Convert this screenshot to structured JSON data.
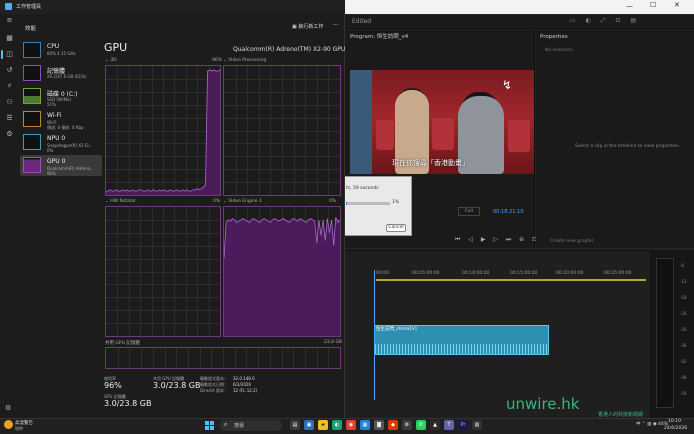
{
  "task_manager": {
    "title": "工作管理員",
    "page_title": "效能",
    "run_new_task": "執行新工作",
    "more": "···",
    "sidebar": [
      {
        "name": "CPU",
        "detail": "60%  4.15 GHz",
        "detail2": ""
      },
      {
        "name": "記憶體",
        "detail": "29.2/47.6 GB (61%)",
        "detail2": ""
      },
      {
        "name": "磁碟 0 (C:)",
        "detail": "SSD (NVMe)",
        "detail2": "51%"
      },
      {
        "name": "Wi-Fi",
        "detail": "Wi-Fi",
        "detail2": "傳送: 0 接收: 0 Kbp"
      },
      {
        "name": "NPU 0",
        "detail": "Snapdragon(R) X2 El...",
        "detail2": "0%"
      },
      {
        "name": "GPU 0",
        "detail": "Qualcomm(R) Adreno...",
        "detail2": "96%"
      }
    ],
    "gpu": {
      "title": "GPU",
      "model": "Qualcomm(R) Adreno(TM) X2-90 GPU",
      "graphs": [
        {
          "label": "3D",
          "pct": "96%"
        },
        {
          "label": "Video Processing",
          "pct": "0%"
        },
        {
          "label": "HW Rotator",
          "pct": "0%"
        },
        {
          "label": "Video Engine 1",
          "pct": "0%"
        }
      ],
      "shared_memory_label": "共用 GPU 記憶體",
      "shared_memory_max": "23.8 GB",
      "stats": {
        "utilization_label": "使用率",
        "utilization_value": "96%",
        "shared_label": "共用 GPU 記憶體",
        "shared_value": "3.0/23.8 GB",
        "gpu_memory_label": "GPU 記憶體",
        "gpu_memory_value": "3.0/23.8 GB",
        "driver_version_label": "驅動程式版本：",
        "driver_version_value": "32.0.148.0",
        "driver_date_label": "驅動程式日期：",
        "driver_date_value": "6/3/2026",
        "directx_label": "DirectX 版本：",
        "directx_value": "12 (FL 12.2)"
      }
    }
  },
  "premiere": {
    "edited": "Edited",
    "program_title": "Program: 恒生訪問_v4",
    "subtitle": "現在你搜尋「香港動畫」",
    "properties_title": "Properties",
    "properties_nosel": "No selection",
    "properties_hint": "Select a clip in the timeline to view properties.",
    "zoom": "Full",
    "timecode": "00:18:21:10",
    "create_graphic": "Create new graphic",
    "dialog": {
      "title": "ts, 59 seconds",
      "pct": "1%",
      "cancel": "Cancel"
    },
    "ruler": [
      "00:00",
      "00:05:00:00",
      "00:10:00:00",
      "00:15:00:00",
      "00:20:00:00",
      "00:25:00:00"
    ],
    "clip_label": "恒生訪問_shrink[V]",
    "meter_labels": [
      "-6",
      "-12",
      "-18",
      "-24",
      "-30",
      "-36",
      "-42",
      "-48",
      "-54"
    ]
  },
  "taskbar": {
    "weather_line1": "高溫警告",
    "weather_line2": "現時",
    "search_placeholder": "搜尋",
    "tray": "中  ⌃  ▥  ◉  44%",
    "time": "10:10",
    "date": "24/6/2026"
  },
  "watermark": {
    "text": "unwire.hk",
    "sub": "香港人的科技新聞網"
  },
  "chart_data": {
    "type": "line",
    "series": [
      {
        "name": "3D",
        "values": [
          3,
          3,
          4,
          3,
          3,
          4,
          3,
          3,
          4,
          3,
          4,
          3,
          3,
          4,
          3,
          3,
          4,
          4,
          3,
          3,
          4,
          3,
          3,
          4,
          3,
          3,
          4,
          3,
          4,
          3,
          3,
          4,
          3,
          3,
          4,
          3,
          3,
          4,
          3,
          4,
          3,
          3,
          4,
          4,
          5,
          4,
          5,
          6,
          8,
          96,
          97,
          96,
          97,
          96,
          96,
          97
        ]
      },
      {
        "name": "Video Engine 1",
        "values": [
          60,
          88,
          90,
          89,
          91,
          90,
          88,
          89,
          90,
          91,
          90,
          89,
          88,
          90,
          91,
          90,
          89,
          88,
          90,
          91,
          90,
          89,
          88,
          90,
          91,
          90,
          89,
          90,
          91,
          90,
          89,
          88,
          90,
          91,
          90,
          89,
          91,
          90,
          89,
          88,
          90,
          91,
          90,
          89,
          72,
          90,
          78,
          90,
          74,
          91,
          80,
          90,
          70,
          92,
          88,
          90
        ]
      }
    ],
    "ylim": [
      0,
      100
    ]
  }
}
